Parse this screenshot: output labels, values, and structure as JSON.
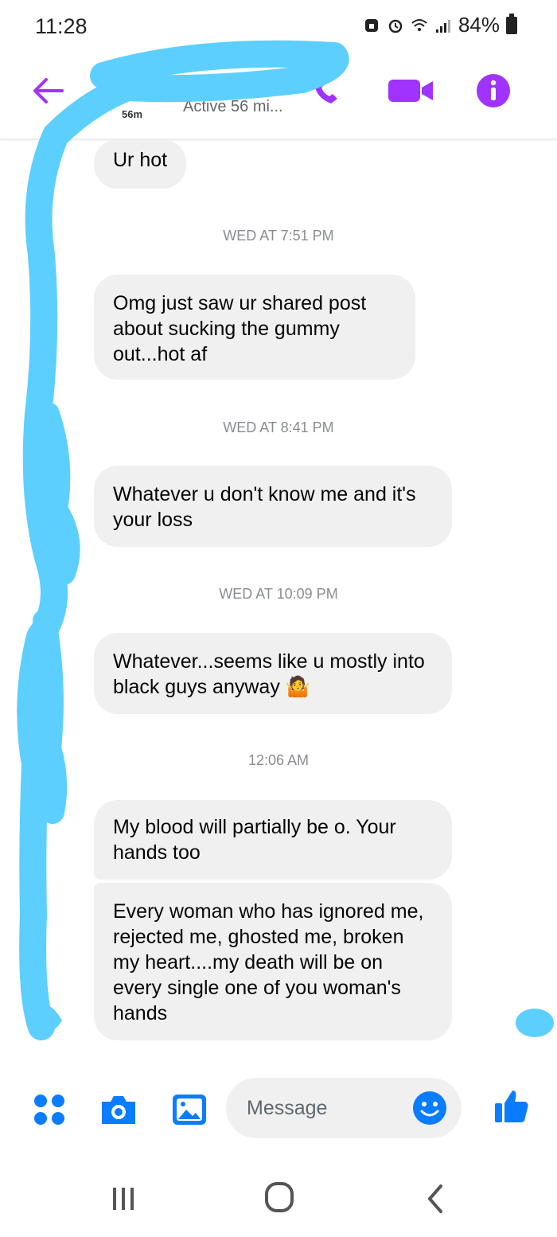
{
  "status_bar": {
    "time": "11:28",
    "battery": "84%"
  },
  "header": {
    "presence_badge": "56m",
    "active_status": "Active 56 mi..."
  },
  "messages": [
    {
      "type": "bubble",
      "text": "Ur hot"
    },
    {
      "type": "timestamp",
      "text": "WED AT 7:51 PM"
    },
    {
      "type": "bubble",
      "text": "Omg just saw ur shared post about  sucking the gummy out...hot af"
    },
    {
      "type": "timestamp",
      "text": "WED AT 8:41 PM"
    },
    {
      "type": "bubble",
      "text": "Whatever u don't know me and it's your loss"
    },
    {
      "type": "timestamp",
      "text": "WED AT 10:09 PM"
    },
    {
      "type": "bubble",
      "text": "Whatever...seems like u mostly into black guys anyway 🤷"
    },
    {
      "type": "timestamp",
      "text": "12:06 AM"
    },
    {
      "type": "bubble",
      "text": "My blood will partially be o. Your hands too"
    },
    {
      "type": "bubble",
      "text": "Every woman who has ignored me, rejected me, ghosted me, broken my heart....my death will be on every single one of you woman's hands"
    }
  ],
  "composer": {
    "placeholder": "Message"
  },
  "colors": {
    "accent_purple": "#a033ff",
    "messenger_blue": "#0a7cff",
    "scribble_blue": "#5ccfff",
    "bubble_bg": "#f0f0f0"
  },
  "icons": [
    "back-arrow-icon",
    "phone-icon",
    "video-camera-icon",
    "info-icon",
    "grid-icon",
    "camera-icon",
    "gallery-icon",
    "emoji-icon",
    "thumbs-up-icon"
  ]
}
